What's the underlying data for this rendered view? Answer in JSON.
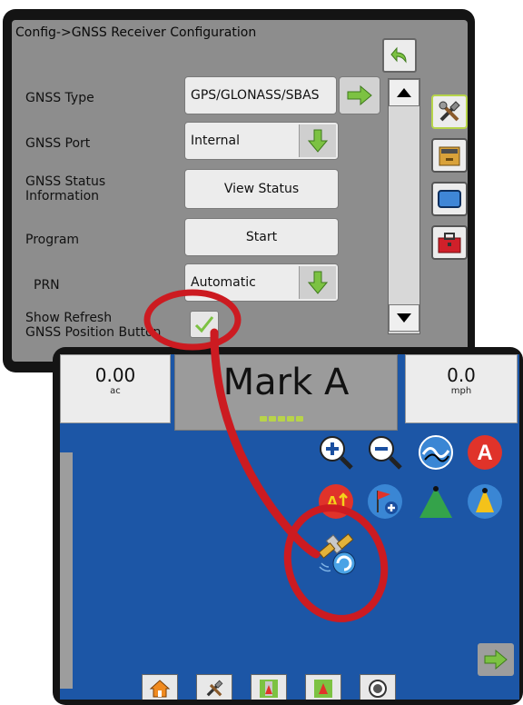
{
  "config": {
    "title": "Config->GNSS Receiver Configuration",
    "rows": [
      {
        "label": "GNSS Type",
        "value": "GPS/GLONASS/SBAS"
      },
      {
        "label": "GNSS Port",
        "value": "Internal"
      },
      {
        "label_line1": "GNSS Status",
        "label_line2": "Information",
        "value": "View Status"
      },
      {
        "label": "Program",
        "value": "Start"
      },
      {
        "label": "PRN",
        "value": "Automatic"
      },
      {
        "label_line1": "Show Refresh",
        "label_line2": "GNSS Position Button",
        "checked": true
      }
    ],
    "side_tabs": [
      "tools-icon",
      "console-icon",
      "display-icon",
      "toolbox-icon"
    ]
  },
  "guidance": {
    "area_value": "0.00",
    "area_unit": "ac",
    "mark_label": "Mark A",
    "speed_value": "0.0",
    "speed_unit": "mph",
    "gps_quality_dots": 5,
    "icons_row1": [
      "zoom-in-icon",
      "zoom-out-icon",
      "curve-mode-icon",
      "mark-a-icon"
    ],
    "icons_row2": [
      "a-plus-nudge-icon",
      "add-flag-icon",
      "vehicle-view-icon",
      "rotate-view-icon"
    ],
    "refresh_icon": "refresh-gnss-position-icon",
    "bottom_tabs": [
      "home-icon",
      "tools-icon",
      "vehicle-view-tab-icon",
      "field-view-tab-icon",
      "camera-icon"
    ]
  },
  "colors": {
    "annotation_red": "#cc1b21",
    "map_blue": "#1c56a6",
    "green_arrow": "#7cc242"
  }
}
